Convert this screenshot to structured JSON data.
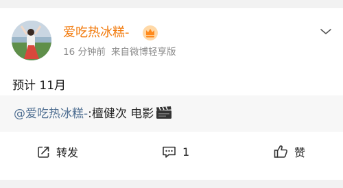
{
  "post": {
    "username": "爱吃热冰糕-",
    "time": "16 分钟前",
    "source": "来自微博轻享版",
    "text": "预计 11月",
    "repost": {
      "mention": "@爱吃热冰糕-",
      "rest": ":檀健次 电影"
    }
  },
  "actions": {
    "repost_label": "转发",
    "comment_count": "1",
    "like_label": "赞"
  },
  "icons": {
    "badge": "crown-badge-icon",
    "more": "chevron-down-icon",
    "movie": "clapperboard-icon",
    "repost": "share-icon",
    "comment": "comment-icon",
    "like": "thumbs-up-icon"
  },
  "colors": {
    "username": "#f27a0c",
    "mention": "#4e6e91",
    "meta": "#8a8a8a",
    "background": "#f2f2f2",
    "repost_background": "#f7f7f7"
  }
}
